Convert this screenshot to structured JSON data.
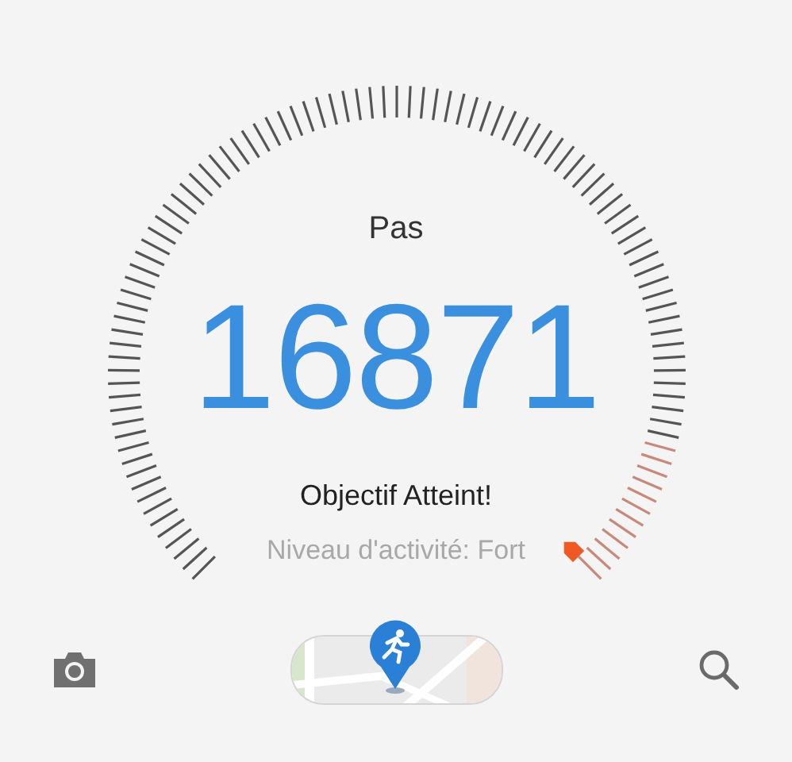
{
  "label": "Pas",
  "count": "16871",
  "status": "Objectif Atteint!",
  "activity": "Niveau d'activité: Fort"
}
